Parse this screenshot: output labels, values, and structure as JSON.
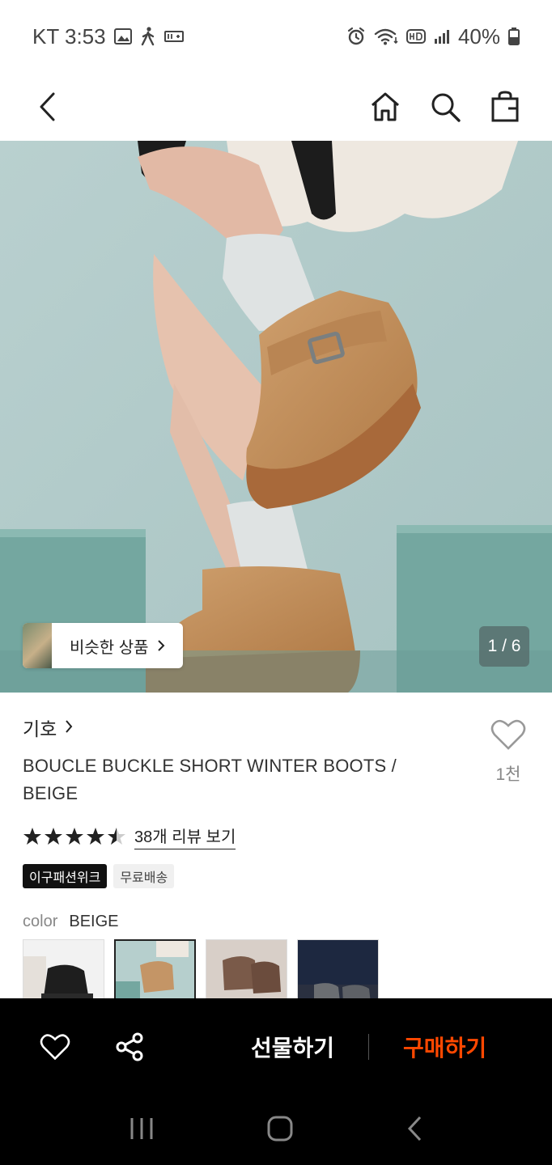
{
  "status_bar": {
    "carrier_time": "KT 3:53",
    "battery": "40%"
  },
  "header": {
    "icons": [
      "back-icon",
      "home-icon",
      "search-icon",
      "shopping-bag-icon"
    ]
  },
  "hero": {
    "similar_label": "비슷한 상품",
    "counter": "1 / 6"
  },
  "product": {
    "brand": "기호",
    "title": "BOUCLE BUCKLE SHORT WINTER BOOTS / BEIGE",
    "likes_count": "1천",
    "rating": 4.5,
    "review_link": "38개 리뷰 보기",
    "badges": [
      "이구패션위크",
      "무료배송"
    ],
    "color_label": "color",
    "color_value": "BEIGE",
    "color_options": [
      "black",
      "beige",
      "brown",
      "gray"
    ],
    "selected_color_index": 1
  },
  "action_bar": {
    "gift_label": "선물하기",
    "buy_label": "구매하기"
  },
  "colors": {
    "accent": "#ff4800",
    "action_bar_bg": "#000000"
  }
}
